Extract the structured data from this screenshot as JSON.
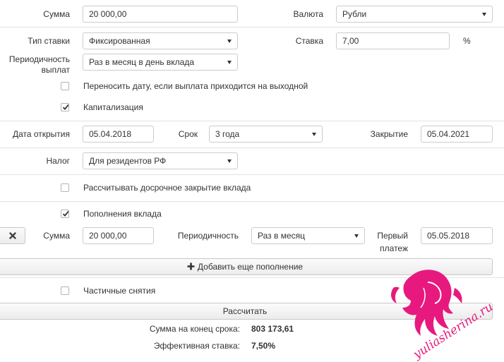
{
  "deposit": {
    "amount_label": "Сумма",
    "amount_value": "20 000,00",
    "currency_label": "Валюта",
    "currency_value": "Рубли",
    "rate_type_label": "Тип ставки",
    "rate_type_value": "Фиксированная",
    "rate_label": "Ставка",
    "rate_value": "7,00",
    "rate_unit": "%",
    "payout_label_line1": "Периодичность",
    "payout_label_line2": "выплат",
    "payout_value": "Раз в месяц в день вклада",
    "move_date_label": "Переносить дату, если выплата приходится на выходной",
    "move_date_checked": false,
    "capitalization_label": "Капитализация",
    "capitalization_checked": true
  },
  "dates": {
    "open_label": "Дата открытия",
    "open_value": "05.04.2018",
    "term_label": "Срок",
    "term_value": "3 года",
    "close_label": "Закрытие",
    "close_value": "05.04.2021"
  },
  "tax": {
    "label": "Налог",
    "value": "Для резидентов РФ"
  },
  "early_close": {
    "label": "Рассчитывать досрочное закрытие вклада",
    "checked": false
  },
  "topups": {
    "label": "Пополнения вклада",
    "checked": true,
    "row": {
      "remove_icon": "close-icon",
      "amount_label": "Сумма",
      "amount_value": "20 000,00",
      "period_label": "Периодичность",
      "period_value": "Раз в месяц",
      "first_label_line1": "Первый",
      "first_label_line2": "платеж",
      "first_value": "05.05.2018"
    },
    "add_button_label": "Добавить еще пополнение",
    "add_icon": "plus-icon"
  },
  "withdrawals": {
    "label": "Частичные снятия",
    "checked": false
  },
  "calculate_button_label": "Рассчитать",
  "results": {
    "total_label": "Сумма на конец срока:",
    "total_value": "803 173,61",
    "effective_label": "Эффективная ставка:",
    "effective_value": "7,50%"
  },
  "watermark": {
    "text": "yuliasherina.ru",
    "color": "#e8197e"
  }
}
